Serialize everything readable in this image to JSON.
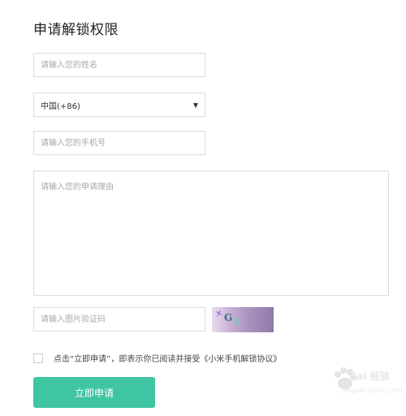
{
  "page": {
    "title": "申请解锁权限"
  },
  "form": {
    "name_placeholder": "请输入您的姓名",
    "country_code_selected": "中国(+86)",
    "phone_placeholder": "请输入您的手机号",
    "reason_placeholder": "请输入您的申请理由",
    "captcha_placeholder": "请输入图片验证码",
    "agreement_text": "点击“立即申请”，即表示你已阅读并接受《小米手机解锁协议》",
    "submit_label": "立即申请"
  },
  "watermark": {
    "text": "Bai 经验",
    "url": "jingyan.baidu.com"
  },
  "colors": {
    "accent": "#3fc5a1",
    "border": "#dcdcdc",
    "placeholder": "#a8a8a8"
  }
}
